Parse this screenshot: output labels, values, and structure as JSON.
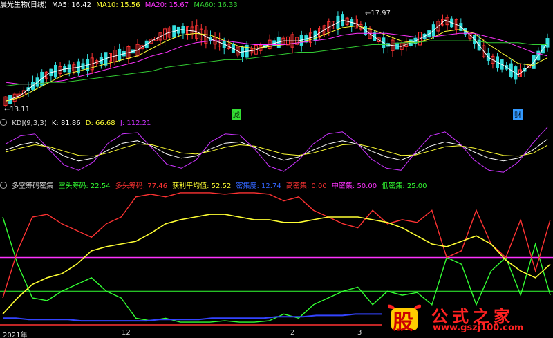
{
  "colors": {
    "up": "#ff3333",
    "down": "#33dddd",
    "ma5": "#ffffff",
    "ma10": "#ffff33",
    "ma20": "#ff33ff",
    "ma60": "#33cc33",
    "bg": "#000000",
    "grid": "#7a1010"
  },
  "panel1": {
    "title": "晨光生物(日线)",
    "ma5_label": "MA5: 16.42",
    "ma10_label": "MA10: 15.56",
    "ma20_label": "MA20: 15.67",
    "ma60_label": "MA60: 16.33",
    "high_marker": "17.97",
    "low_marker": "13.11",
    "event_reduce": "减",
    "event_fin": "财"
  },
  "panel2": {
    "title": "KDJ(9,3,3)",
    "k_label": "K: 81.86",
    "d_label": "D: 66.68",
    "j_label": "J: 112.21"
  },
  "panel3": {
    "title": "多空筹码密集",
    "short_label": "空头筹码: 22.54",
    "long_label": "多头筹码: 77.46",
    "avg_label": "获利平均值: 52.52",
    "dense_label": "密集度: 12.74",
    "high_label": "高密集: 0.00",
    "mid_label": "中密集: 50.00",
    "low_label": "低密集: 25.00"
  },
  "x_axis": {
    "labels": [
      "2021年",
      "12",
      "2",
      "3"
    ]
  },
  "watermark": {
    "big": "股",
    "text": "公式之家",
    "url": "www.gszj100.com"
  },
  "chart_data": [
    {
      "type": "candlestick",
      "title": "晨光生物(日线)",
      "annotations": [
        "17.97",
        "13.11",
        "减",
        "财"
      ],
      "series": [
        {
          "name": "MA5",
          "values": [
            13.3,
            13.6,
            14.2,
            14.8,
            15.0,
            15.1,
            15.3,
            15.6,
            15.8,
            16.0,
            16.5,
            16.9,
            17.1,
            17.0,
            16.6,
            16.3,
            15.9,
            16.0,
            16.3,
            16.5,
            16.5,
            16.7,
            17.2,
            17.6,
            17.4,
            16.8,
            16.3,
            16.2,
            16.5,
            16.9,
            17.6,
            17.3,
            16.6,
            15.6,
            15.2,
            14.7,
            15.3,
            16.4
          ]
        },
        {
          "name": "MA10",
          "values": [
            13.3,
            13.5,
            13.9,
            14.3,
            14.7,
            14.9,
            15.1,
            15.3,
            15.5,
            15.7,
            16.1,
            16.5,
            16.8,
            16.9,
            16.8,
            16.5,
            16.2,
            16.1,
            16.2,
            16.3,
            16.4,
            16.6,
            16.9,
            17.2,
            17.3,
            17.1,
            16.8,
            16.5,
            16.4,
            16.6,
            17.0,
            17.1,
            16.9,
            16.3,
            15.8,
            15.3,
            15.2,
            15.6
          ]
        },
        {
          "name": "MA20",
          "values": [
            14.3,
            14.2,
            14.2,
            14.3,
            14.4,
            14.6,
            14.8,
            15.0,
            15.2,
            15.4,
            15.7,
            15.9,
            16.2,
            16.4,
            16.5,
            16.5,
            16.4,
            16.3,
            16.3,
            16.3,
            16.4,
            16.5,
            16.6,
            16.8,
            16.9,
            16.9,
            16.9,
            16.8,
            16.7,
            16.7,
            16.8,
            16.9,
            16.9,
            16.7,
            16.5,
            16.2,
            15.9,
            15.7
          ]
        },
        {
          "name": "MA60",
          "values": [
            14.1,
            14.2,
            14.2,
            14.3,
            14.3,
            14.4,
            14.5,
            14.6,
            14.7,
            14.8,
            14.9,
            15.1,
            15.2,
            15.3,
            15.4,
            15.5,
            15.5,
            15.6,
            15.7,
            15.8,
            15.9,
            15.9,
            16.0,
            16.1,
            16.2,
            16.3,
            16.3,
            16.4,
            16.4,
            16.5,
            16.5,
            16.5,
            16.5,
            16.4,
            16.4,
            16.4,
            16.3,
            16.3
          ]
        }
      ]
    },
    {
      "type": "line",
      "title": "KDJ(9,3,3)",
      "ylim": [
        -10,
        110
      ],
      "series": [
        {
          "name": "K",
          "values": [
            55,
            68,
            75,
            60,
            40,
            28,
            35,
            55,
            72,
            78,
            65,
            45,
            35,
            40,
            58,
            72,
            75,
            62,
            42,
            30,
            38,
            55,
            70,
            78,
            70,
            52,
            38,
            30,
            45,
            65,
            75,
            68,
            50,
            35,
            28,
            35,
            55,
            82
          ]
        },
        {
          "name": "D",
          "values": [
            50,
            60,
            68,
            63,
            52,
            42,
            40,
            48,
            60,
            70,
            68,
            58,
            48,
            45,
            52,
            62,
            68,
            65,
            55,
            45,
            42,
            48,
            58,
            68,
            70,
            62,
            52,
            42,
            43,
            53,
            63,
            66,
            60,
            50,
            42,
            40,
            47,
            67
          ]
        },
        {
          "name": "J",
          "values": [
            70,
            90,
            95,
            55,
            18,
            5,
            25,
            72,
            95,
            98,
            60,
            20,
            10,
            30,
            75,
            95,
            92,
            58,
            15,
            2,
            30,
            70,
            95,
            100,
            72,
            32,
            10,
            5,
            50,
            90,
            100,
            72,
            30,
            5,
            0,
            25,
            72,
            112
          ]
        }
      ]
    },
    {
      "type": "line",
      "title": "多空筹码密集",
      "ylim": [
        0,
        100
      ],
      "series": [
        {
          "name": "空头筹码",
          "values": [
            80,
            45,
            20,
            18,
            25,
            30,
            35,
            25,
            20,
            5,
            3,
            5,
            2,
            2,
            2,
            3,
            2,
            2,
            3,
            8,
            5,
            15,
            20,
            25,
            28,
            15,
            25,
            22,
            24,
            15,
            50,
            45,
            15,
            40,
            50,
            22,
            60,
            22
          ]
        },
        {
          "name": "多头筹码",
          "values": [
            20,
            55,
            80,
            82,
            75,
            70,
            65,
            75,
            80,
            95,
            97,
            95,
            98,
            98,
            98,
            97,
            98,
            98,
            97,
            92,
            95,
            85,
            80,
            75,
            72,
            85,
            75,
            78,
            76,
            85,
            50,
            55,
            85,
            60,
            50,
            78,
            40,
            78
          ]
        },
        {
          "name": "获利平均值",
          "values": [
            8,
            20,
            30,
            35,
            38,
            45,
            55,
            58,
            60,
            62,
            68,
            75,
            78,
            80,
            82,
            82,
            80,
            78,
            78,
            76,
            76,
            78,
            80,
            80,
            80,
            78,
            76,
            72,
            66,
            60,
            58,
            62,
            66,
            60,
            48,
            40,
            35,
            45
          ]
        },
        {
          "name": "密集度",
          "values": [
            5,
            5,
            4,
            4,
            4,
            4,
            3,
            3,
            3,
            3,
            3,
            3,
            4,
            4,
            4,
            4,
            5,
            5,
            5,
            5,
            5,
            6,
            6,
            6,
            7,
            7,
            7,
            8,
            8,
            8
          ]
        },
        {
          "name": "中密集",
          "values": [
            50
          ]
        },
        {
          "name": "低密集",
          "values": [
            25
          ]
        }
      ]
    }
  ]
}
